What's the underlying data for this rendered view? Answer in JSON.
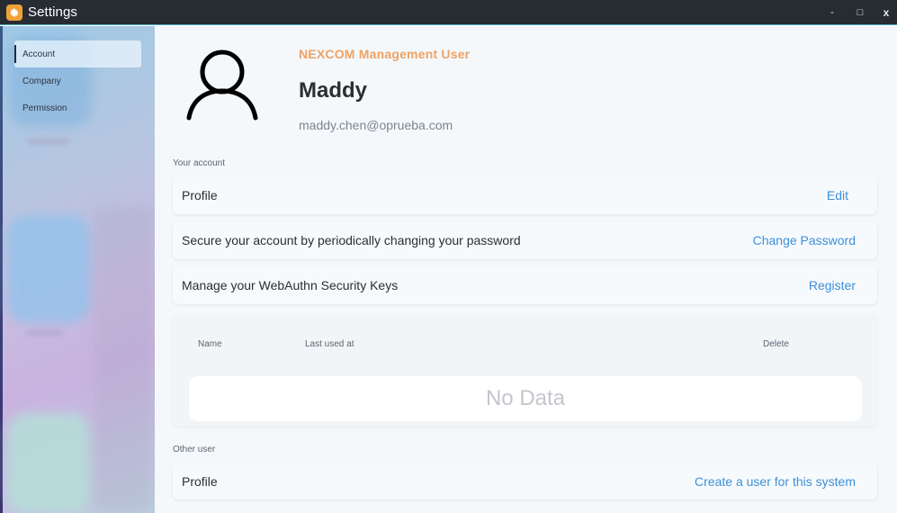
{
  "window": {
    "title": "Settings",
    "icon": "gear-icon",
    "controls": {
      "minimize": "-",
      "maximize": "□",
      "close": "x"
    }
  },
  "sidebar": {
    "items": [
      {
        "label": "Account",
        "active": true
      },
      {
        "label": "Company",
        "active": false
      },
      {
        "label": "Permission",
        "active": false
      }
    ]
  },
  "profile": {
    "avatar_icon": "user-icon",
    "organization": "NEXCOM Management User",
    "name": "Maddy",
    "email": "maddy.chen@oprueba.com"
  },
  "your_account": {
    "section_label": "Your account",
    "rows": [
      {
        "label": "Profile",
        "action": "Edit"
      },
      {
        "label": "Secure your account by periodically changing your password",
        "action": "Change Password"
      },
      {
        "label": "Manage your WebAuthn Security Keys",
        "action": "Register"
      }
    ],
    "keys_table": {
      "columns": [
        "Name",
        "Last used at",
        "Delete"
      ],
      "empty_text": "No Data"
    }
  },
  "other_user": {
    "section_label": "Other user",
    "row": {
      "label": "Profile",
      "action": "Create a user for this system"
    }
  },
  "colors": {
    "accent_orange": "#f0a264",
    "link_blue": "#3d8fd8",
    "titlebar": "#272c33"
  }
}
